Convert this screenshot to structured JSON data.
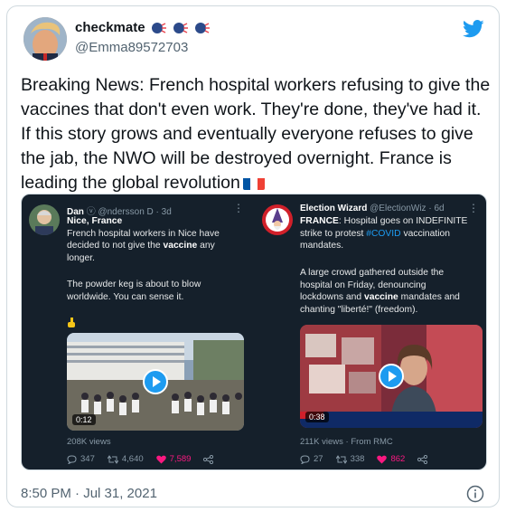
{
  "tweet": {
    "display_name": "checkmate",
    "emoji": [
      "speaking-head",
      "speaking-head",
      "speaking-head"
    ],
    "handle": "@Emma89572703",
    "text": "Breaking News: French hospital workers refusing to give the vaccines that don't even work. They're done, they've had it. If this story grows and eventually everyone refuses to give the jab, the NWO will be destroyed overnight. France is leading the global revolution",
    "flag_emoji": "france-flag",
    "timestamp": "8:50 PM · Jul 31, 2021"
  },
  "embedded": {
    "left": {
      "name": "Dan",
      "handle": "@ndersson D",
      "time": "3d",
      "line1_b": "Nice, France",
      "line2": "French hospital workers in Nice have",
      "line3_pre": "decided to not give the ",
      "line3_b": "vaccine",
      "line3_post": " any",
      "line4": "longer.",
      "para2_1": "The powder keg is about to blow",
      "para2_2": "worldwide. You can sense it.",
      "duration": "0:12",
      "views": "208K views",
      "replies": "347",
      "retweets": "4,640",
      "likes": "7,589"
    },
    "right": {
      "name": "Election Wizard",
      "handle": "@ElectionWiz",
      "time": "6d",
      "line1_b": "FRANCE",
      "line1_post": ": Hospital goes on INDEFINITE",
      "line2_pre": "strike to protest ",
      "line2_tag": "#COVID",
      "line2_post": " vaccination",
      "line3": "mandates.",
      "p2_1": "A large crowd gathered outside the",
      "p2_2": "hospital on Friday, denouncing",
      "p2_3_pre": "lockdowns and ",
      "p2_3_b": "vaccine",
      "p2_3_post": " mandates and",
      "p2_4": "chanting \"liberté!\" (freedom).",
      "duration": "0:38",
      "views": "211K views · From RMC",
      "replies": "27",
      "retweets": "338",
      "likes": "862"
    }
  },
  "colors": {
    "accent": "#1d9bf0",
    "like": "#f91880",
    "embed_bg": "#15202b",
    "muted": "#536471"
  }
}
